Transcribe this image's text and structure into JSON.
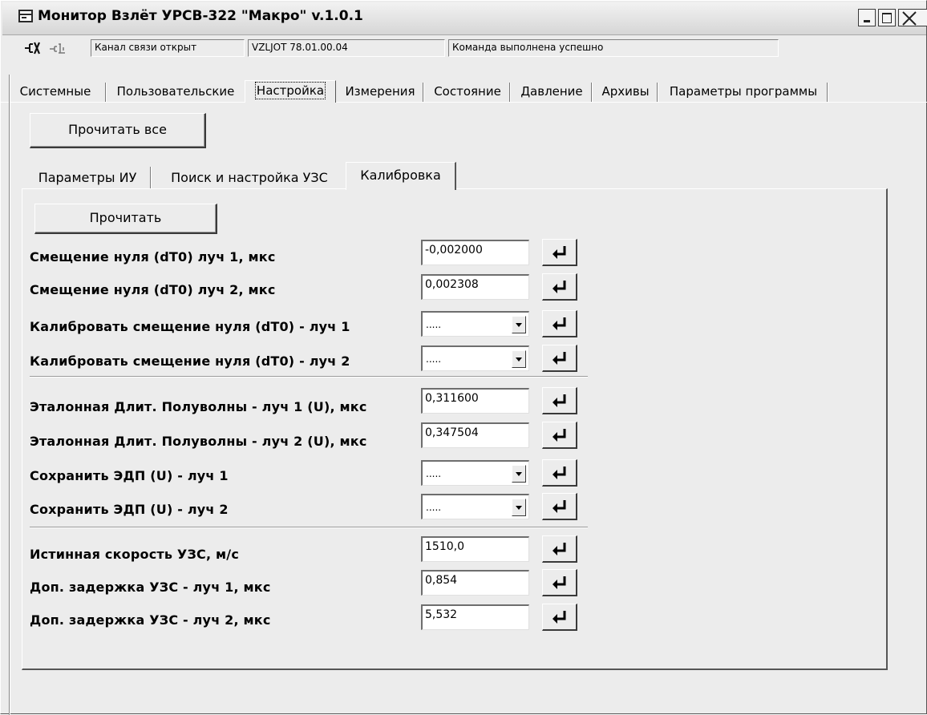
{
  "window": {
    "title": "Монитор Взлёт УРСВ-322 \"Макро\" v.1.0.1"
  },
  "status": {
    "channel": "Канал связи открыт",
    "device": "VZLJOT 78.01.00.04",
    "message": "Команда выполнена успешно"
  },
  "main_tabs": [
    {
      "label": "Системные"
    },
    {
      "label": "Пользовательские"
    },
    {
      "label": "Настройка",
      "active": true
    },
    {
      "label": "Измерения"
    },
    {
      "label": "Состояние"
    },
    {
      "label": "Давление"
    },
    {
      "label": "Архивы"
    },
    {
      "label": "Параметры программы"
    }
  ],
  "read_all_label": "Прочитать все",
  "sub_tabs": [
    {
      "label": "Параметры ИУ"
    },
    {
      "label": "Поиск и настройка УЗС"
    },
    {
      "label": "Калибровка",
      "active": true
    }
  ],
  "read_label": "Прочитать",
  "rows": [
    {
      "label": "Смещение нуля (dT0) луч 1, мкс",
      "value": "-0,002000",
      "type": "input"
    },
    {
      "label": "Смещение нуля (dT0) луч 2, мкс",
      "value": "0,002308",
      "type": "input"
    },
    {
      "label": "Калибровать смещение нуля (dT0) - луч 1",
      "value": ".....",
      "type": "combo"
    },
    {
      "label": "Калибровать смещение нуля (dT0) - луч 2",
      "value": ".....",
      "type": "combo"
    },
    {
      "label": "Эталонная Длит. Полуволны - луч 1 (U), мкс",
      "value": "0,311600",
      "type": "input"
    },
    {
      "label": "Эталонная Длит. Полуволны - луч 2 (U), мкс",
      "value": "0,347504",
      "type": "input"
    },
    {
      "label": "Сохранить ЭДП (U) - луч 1",
      "value": ".....",
      "type": "combo"
    },
    {
      "label": "Сохранить ЭДП (U) - луч 2",
      "value": ".....",
      "type": "combo"
    },
    {
      "label": "Истинная скорость УЗС, м/с",
      "value": "1510,0",
      "type": "input"
    },
    {
      "label": "Доп. задержка УЗС - луч 1, мкс",
      "value": "0,854",
      "type": "input"
    },
    {
      "label": "Доп. задержка УЗС - луч 2, мкс",
      "value": "5,532",
      "type": "input"
    }
  ]
}
